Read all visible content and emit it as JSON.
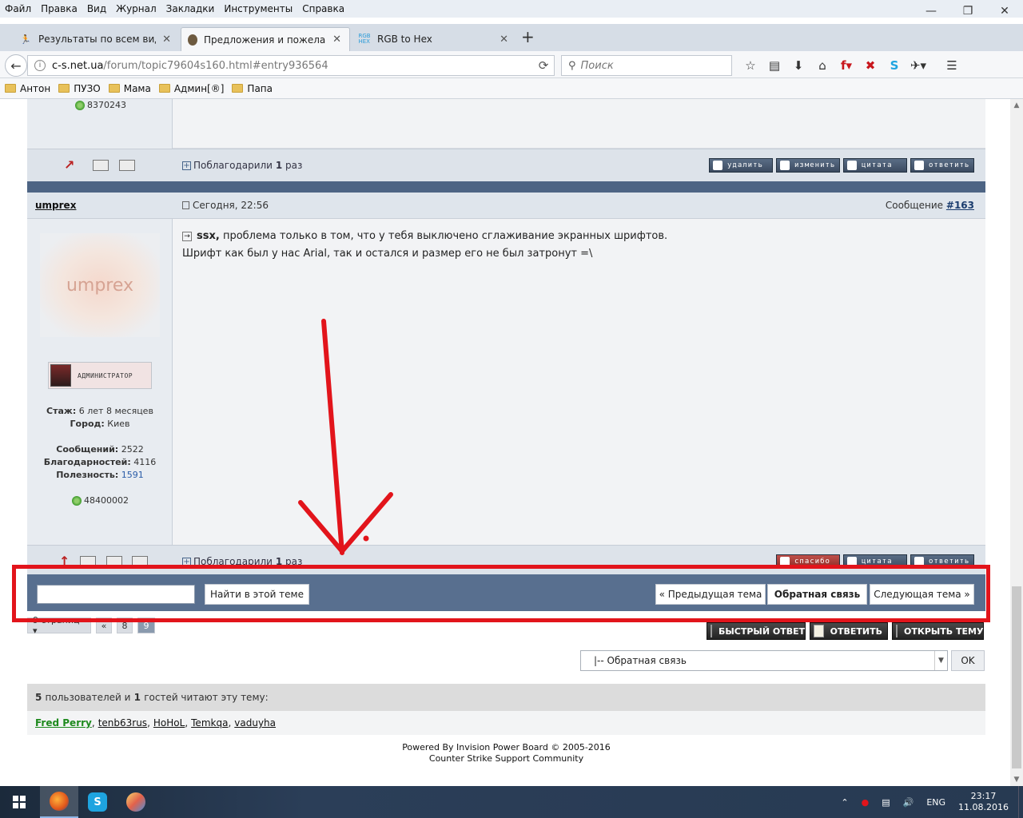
{
  "menu": [
    "Файл",
    "Правка",
    "Вид",
    "Журнал",
    "Закладки",
    "Инструменты",
    "Справка"
  ],
  "tabs": [
    {
      "title": "Результаты по всем вида...",
      "icon": "runner-icon",
      "active": false
    },
    {
      "title": "Предложения и пожелан...",
      "icon": "avatar-icon",
      "active": true
    },
    {
      "title": "RGB to Hex",
      "icon": "rgb-hex-icon",
      "active": false
    }
  ],
  "urlbar": {
    "host": "c-s.net.ua",
    "path": "/forum/topic79604s160.html#entry936564"
  },
  "search": {
    "placeholder": "Поиск"
  },
  "bookmarks": [
    "Антон",
    "ПУЗО",
    "Мама",
    "Админ[®]",
    "Папа"
  ],
  "post1": {
    "icq": "8370243",
    "thanks_prefix": "Поблагодарили",
    "thanks_count": "1",
    "thanks_suffix": "раз",
    "buttons": [
      "удалить",
      "изменить",
      "цитата",
      "ответить"
    ]
  },
  "post2": {
    "author": "umprex",
    "date": "Сегодня, 22:56",
    "num_label": "Сообщение",
    "num": "#163",
    "avatar_text": "umprex",
    "group": "администратор",
    "stats": {
      "tenure_label": "Стаж:",
      "tenure": "6 лет 8 месяцев",
      "city_label": "Город:",
      "city": "Киев",
      "posts_label": "Сообщений:",
      "posts": "2522",
      "thanks_label": "Благодарностей:",
      "thanks": "4116",
      "useful_label": "Полезность:",
      "useful": "1591"
    },
    "icq": "48400002",
    "quote_name": "ssx,",
    "line1": "проблема только в том, что у тебя выключено сглаживание экранных шрифтов.",
    "line2": "Шрифт как был у нас Arial, так и остался и размер его не был затронут =\\",
    "thanks_prefix": "Поблагодарили",
    "thanks_count": "1",
    "thanks_suffix": "раз",
    "buttons": [
      "спасибо",
      "цитата",
      "ответить"
    ]
  },
  "bottom_nav": {
    "find_button": "Найти в этой теме",
    "prev_topic": "« Предыдущая тема",
    "feedback": "Обратная связь",
    "next_topic": "Следующая тема »"
  },
  "pager": {
    "pages_label": "9 страниц ▾",
    "prev": "«",
    "p8": "8",
    "p9": "9"
  },
  "actions": {
    "quick_reply": "БЫСТРЫЙ ОТВЕТ",
    "reply": "ОТВЕТИТЬ",
    "new_topic": "ОТКРЫТЬ ТЕМУ"
  },
  "forum_jump": {
    "selected": "|-- Обратная связь",
    "ok": "OK"
  },
  "readers": {
    "count_users": "5",
    "users_text": "пользователей и",
    "count_guests": "1",
    "guests_text": "гостей читают эту тему:",
    "list": [
      "Fred Perry",
      "tenb63rus",
      "HoHoL",
      "Temkqa",
      "vaduyha"
    ]
  },
  "footer": {
    "line1": "Powered By Invision Power Board  © 2005-2016",
    "line2": "Counter Strike Support Community"
  },
  "taskbar": {
    "lang": "ENG",
    "time": "23:17",
    "date": "11.08.2016"
  },
  "colors": {
    "accent_red": "#e2141b",
    "forum_nav": "#586f8f",
    "separator": "#4d6484"
  }
}
